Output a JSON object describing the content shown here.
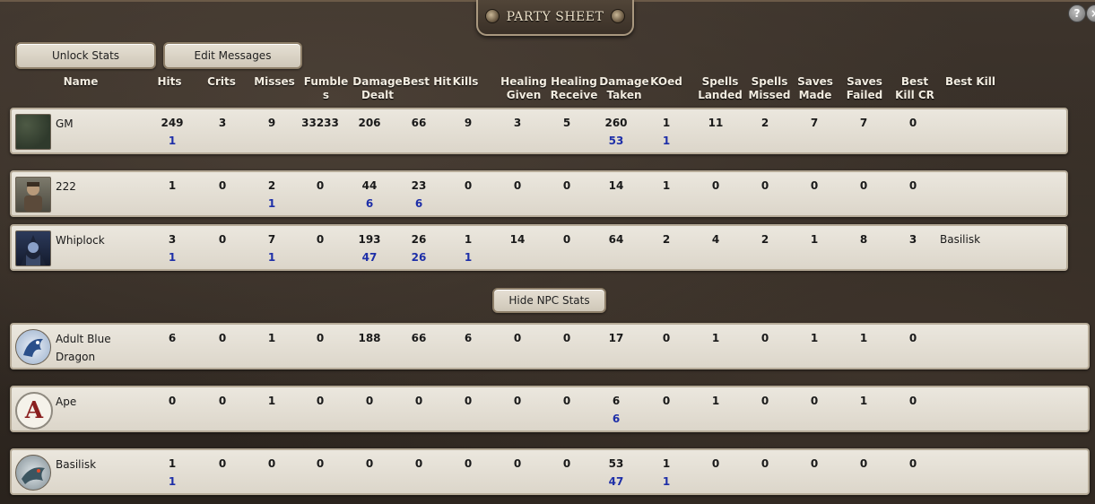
{
  "window": {
    "title": "PARTY SHEET",
    "help_label": "?",
    "close_label": "×"
  },
  "toolbar": {
    "unlock_label": "Unlock Stats",
    "edit_label": "Edit Messages"
  },
  "npc_toggle_label": "Hide NPC Stats",
  "columns": [
    "Name",
    "Hits",
    "Crits",
    "Misses",
    "Fumbles",
    "Damage Dealt",
    "Best Hit",
    "Kills",
    "Healing Given",
    "Healing Receive",
    "Damage Taken",
    "KOed",
    "Spells Landed",
    "Spells Missed",
    "Saves Made",
    "Saves Failed",
    "Best Kill CR",
    "Best Kill"
  ],
  "column_headers": {
    "name": "Name",
    "hits": "Hits",
    "crits": "Crits",
    "misses": "Misses",
    "fumbles_1": "Fumble",
    "fumbles_2": "s",
    "dmg_dealt_1": "Damage",
    "dmg_dealt_2": "Dealt",
    "best_hit": "Best Hit",
    "kills": "Kills",
    "heal_given_1": "Healing",
    "heal_given_2": "Given",
    "heal_recv_1": "Healing",
    "heal_recv_2": "Receive",
    "dmg_taken_1": "Damage",
    "dmg_taken_2": "Taken",
    "koed": "KOed",
    "spells_landed_1": "Spells",
    "spells_landed_2": "Landed",
    "spells_missed_1": "Spells",
    "spells_missed_2": "Missed",
    "saves_made_1": "Saves",
    "saves_made_2": "Made",
    "saves_failed_1": "Saves",
    "saves_failed_2": "Failed",
    "best_kill_cr_1": "Best",
    "best_kill_cr_2": "Kill CR",
    "best_kill": "Best Kill"
  },
  "pcs": [
    {
      "name": "GM",
      "avatar": "map-avatar",
      "top": [
        "249",
        "3",
        "9",
        "33233",
        "206",
        "66",
        "9",
        "3",
        "5",
        "260",
        "1",
        "11",
        "2",
        "7",
        "7",
        "0",
        ""
      ],
      "bottom": [
        "1",
        "",
        "",
        "",
        "",
        "",
        "",
        "",
        "",
        "53",
        "1",
        "",
        "",
        "",
        "",
        "",
        ""
      ]
    },
    {
      "name": "222",
      "avatar": "warrior-avatar",
      "top": [
        "1",
        "0",
        "2",
        "0",
        "44",
        "23",
        "0",
        "0",
        "0",
        "14",
        "1",
        "0",
        "0",
        "0",
        "0",
        "0",
        ""
      ],
      "bottom": [
        "",
        "",
        "1",
        "",
        "6",
        "6",
        "",
        "",
        "",
        "",
        "",
        "",
        "",
        "",
        "",
        "",
        ""
      ]
    },
    {
      "name": "Whiplock",
      "avatar": "warlock-avatar",
      "top": [
        "3",
        "0",
        "7",
        "0",
        "193",
        "26",
        "1",
        "14",
        "0",
        "64",
        "2",
        "4",
        "2",
        "1",
        "8",
        "3",
        "Basilisk"
      ],
      "bottom": [
        "1",
        "",
        "1",
        "",
        "47",
        "26",
        "1",
        "",
        "",
        "",
        "",
        "",
        "",
        "",
        "",
        "",
        ""
      ]
    }
  ],
  "npcs": [
    {
      "name": "Adult Blue",
      "name2": "Dragon",
      "avatar": "dragon-avatar",
      "top": [
        "6",
        "0",
        "1",
        "0",
        "188",
        "66",
        "6",
        "0",
        "0",
        "17",
        "0",
        "1",
        "0",
        "1",
        "1",
        "0",
        ""
      ],
      "bottom": [
        "",
        "",
        "",
        "",
        "",
        "",
        "",
        "",
        "",
        "",
        "",
        "",
        "",
        "",
        "",
        "",
        ""
      ]
    },
    {
      "name": "Ape",
      "avatar": "letter-a-avatar",
      "avatar_letter": "A",
      "top": [
        "0",
        "0",
        "1",
        "0",
        "0",
        "0",
        "0",
        "0",
        "0",
        "6",
        "0",
        "1",
        "0",
        "0",
        "1",
        "0",
        ""
      ],
      "bottom": [
        "",
        "",
        "",
        "",
        "",
        "",
        "",
        "",
        "",
        "6",
        "",
        "",
        "",
        "",
        "",
        "",
        ""
      ]
    },
    {
      "name": "Basilisk",
      "avatar": "basilisk-avatar",
      "top": [
        "1",
        "0",
        "0",
        "0",
        "0",
        "0",
        "0",
        "0",
        "0",
        "53",
        "1",
        "0",
        "0",
        "0",
        "0",
        "0",
        ""
      ],
      "bottom": [
        "1",
        "",
        "",
        "",
        "",
        "",
        "",
        "",
        "",
        "47",
        "1",
        "",
        "",
        "",
        "",
        "",
        ""
      ]
    }
  ],
  "colors": {
    "value": "#1a1a1a",
    "secondary_value": "#1e2fa8",
    "header_text": "#f2ece0"
  }
}
